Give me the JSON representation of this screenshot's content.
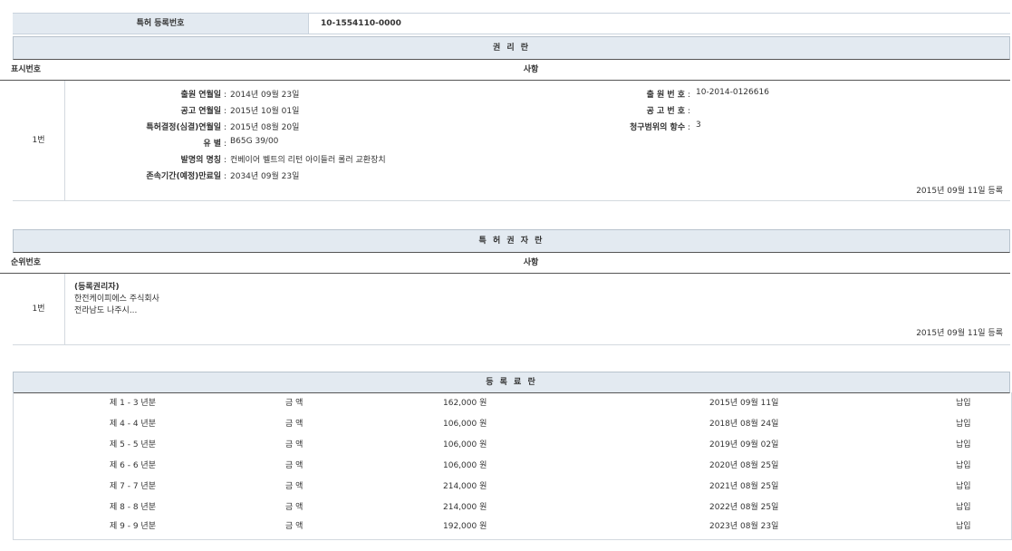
{
  "registration": {
    "label": "특허 등록번호",
    "number": "10-1554110-0000"
  },
  "rights_section": {
    "title": "권 리 란",
    "col_no": "표시번호",
    "col_matter": "사항",
    "row_no": "1번",
    "fields_left": [
      {
        "label": "출원 연월일",
        "value": "2014년 09월 23일"
      },
      {
        "label": "공고 연월일",
        "value": "2015년 10월 01일"
      },
      {
        "label": "특허결정(심결)연월일",
        "value": "2015년 08월 20일"
      },
      {
        "label": "유 별",
        "value": "B65G 39/00"
      },
      {
        "label": "발명의 명칭",
        "value": "컨베이어 벨트의 리턴 아이들러 롤러 교환장치"
      },
      {
        "label": "존속기간(예정)만료일",
        "value": "2034년 09월 23일"
      }
    ],
    "fields_right": [
      {
        "label": "출 원 번 호",
        "value": "10-2014-0126616"
      },
      {
        "label": "공 고 번 호",
        "value": ""
      },
      {
        "label": "청구범위의 항수",
        "value": "3"
      }
    ],
    "reg_date": "2015년 09월 11일 등록"
  },
  "holder_section": {
    "title": "특 허 권 자 란",
    "col_no": "순위번호",
    "col_matter": "사항",
    "row_no": "1번",
    "lines": [
      "(등록권리자)",
      "한전케이피에스 주식회사",
      "전라남도 나주시..."
    ],
    "reg_date": "2015년 09월 11일 등록"
  },
  "fee_section": {
    "title": "등 록 료 란",
    "rows": [
      {
        "period": "제 1 - 3 년분",
        "amount_label": "금 액",
        "amount": "162,000 원",
        "date": "2015년 09월 11일",
        "status": "납입"
      },
      {
        "period": "제 4 - 4 년분",
        "amount_label": "금 액",
        "amount": "106,000 원",
        "date": "2018년 08월 24일",
        "status": "납입"
      },
      {
        "period": "제 5 - 5 년분",
        "amount_label": "금 액",
        "amount": "106,000 원",
        "date": "2019년 09월 02일",
        "status": "납입"
      },
      {
        "period": "제 6 - 6 년분",
        "amount_label": "금 액",
        "amount": "106,000 원",
        "date": "2020년 08월 25일",
        "status": "납입"
      },
      {
        "period": "제 7 - 7 년분",
        "amount_label": "금 액",
        "amount": "214,000 원",
        "date": "2021년 08월 25일",
        "status": "납입"
      },
      {
        "period": "제 8 - 8 년분",
        "amount_label": "금 액",
        "amount": "214,000 원",
        "date": "2022년 08월 25일",
        "status": "납입"
      },
      {
        "period": "제 9 - 9 년분",
        "amount_label": "금 액",
        "amount": "192,000 원",
        "date": "2023년 08월 23일",
        "status": "납입"
      }
    ]
  }
}
